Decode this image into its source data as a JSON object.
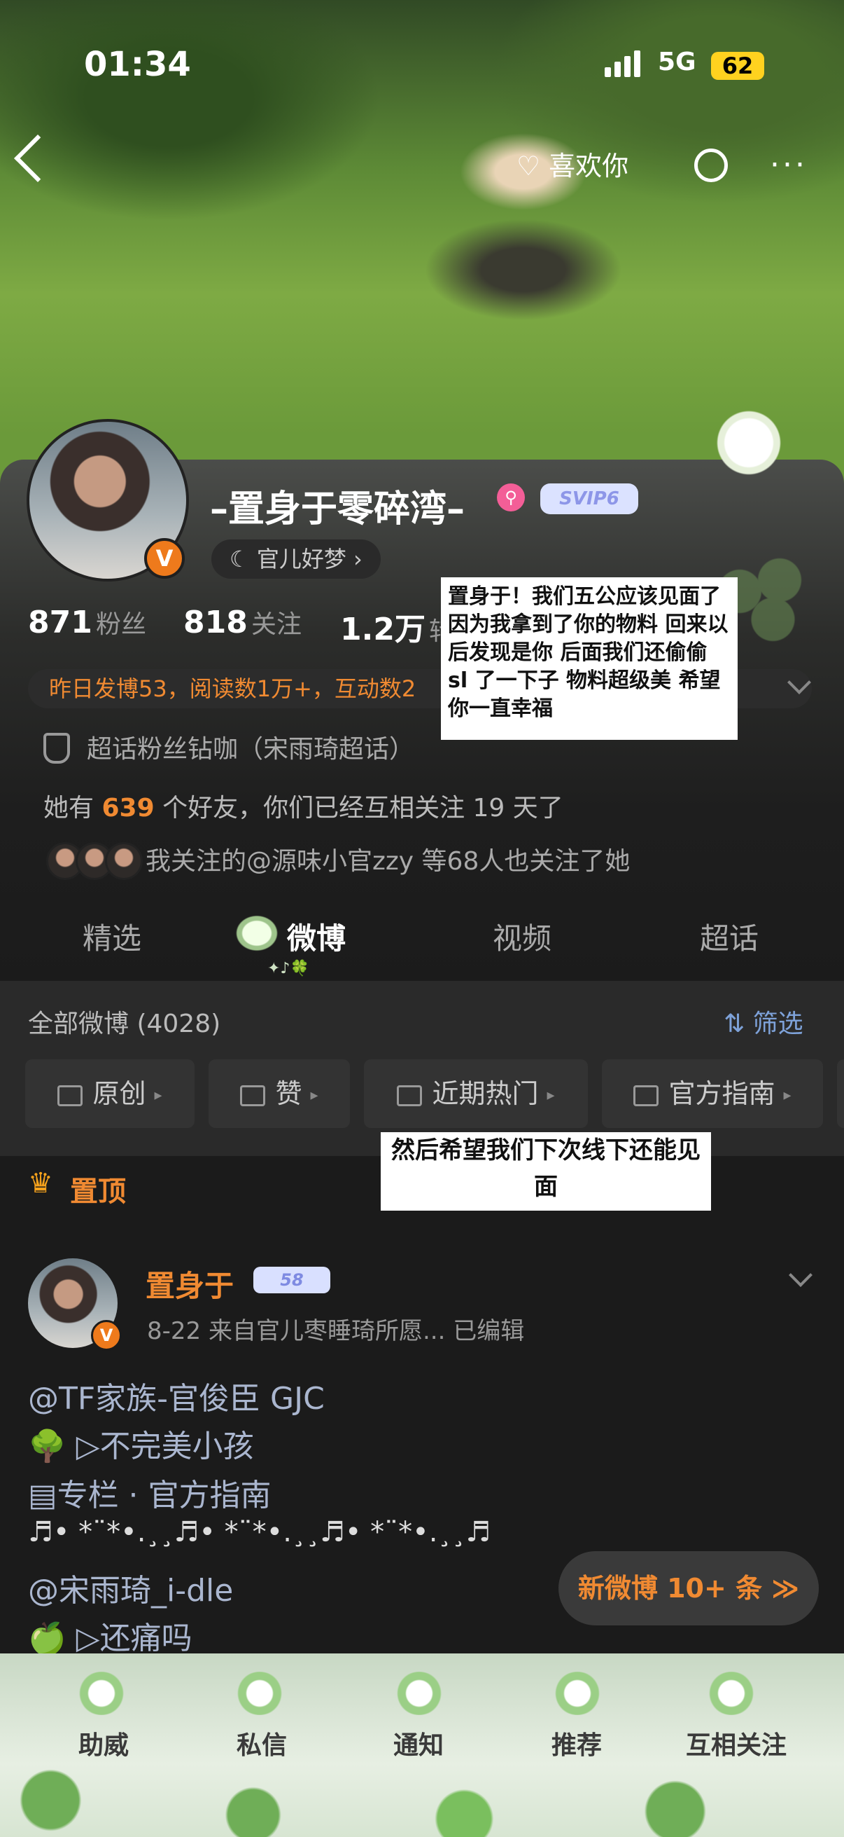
{
  "status": {
    "time": "01:34",
    "network": "5G",
    "battery": "62"
  },
  "header": {
    "like_label": "喜欢你"
  },
  "profile": {
    "name": "–置身于零碎湾–",
    "vip_label": "SVIP6",
    "mood": "官儿好梦 ›",
    "verified_mark": "V",
    "stats": [
      {
        "num": "871",
        "label": "粉丝"
      },
      {
        "num": "818",
        "label": "关注"
      },
      {
        "num": "1.2万",
        "label": "转"
      }
    ],
    "hotline": "昨日发博53，阅读数1万+，互动数2",
    "super_topic": "超话粉丝钻咖（宋雨琦超话）",
    "friends_pre": "她有",
    "friends_count": "639",
    "friends_post": "个好友，你们已经互相关注 19 天了",
    "also_follow": "我关注的@源味小官zzy  等68人也关注了她"
  },
  "tabs": [
    "精选",
    "微博",
    "视频",
    "超话"
  ],
  "tab_deco": "✦♪🍀",
  "filter": {
    "all_count": "全部微博 (4028)",
    "filter_label": "筛选",
    "chips": [
      "原创",
      "赞",
      "近期热门",
      "官方指南"
    ]
  },
  "pinned": {
    "crown": "♛",
    "label": "置顶",
    "name": "置身于",
    "level": "58",
    "meta": "8-22  来自官儿枣睡琦所愿...  已编辑",
    "lines": [
      "@TF家族-官俊臣 GJC",
      "🌳 ▷不完美小孩",
      "▤专栏 · 官方指南",
      "♬• *¨*•.¸¸♬• *¨*•.¸¸♬• *¨*•.¸¸♬",
      "@宋雨琦_i-dle",
      "🍏 ▷还痛吗"
    ],
    "new_posts": "新微博 10+ 条 ≫"
  },
  "bottom_nav": [
    "助威",
    "私信",
    "通知",
    "推荐",
    "互相关注"
  ],
  "captions": {
    "first": "置身于！我们五公应该见面了 因为我拿到了你的物料 回来以后发现是你 后面我们还偷偷 sl 了一下子 物料超级美 希望你一直幸福",
    "second": "然后希望我们下次线下还能见面"
  },
  "colors": {
    "accent": "#f08a32",
    "link": "#aab6cf",
    "vip": "#8d96e8"
  }
}
